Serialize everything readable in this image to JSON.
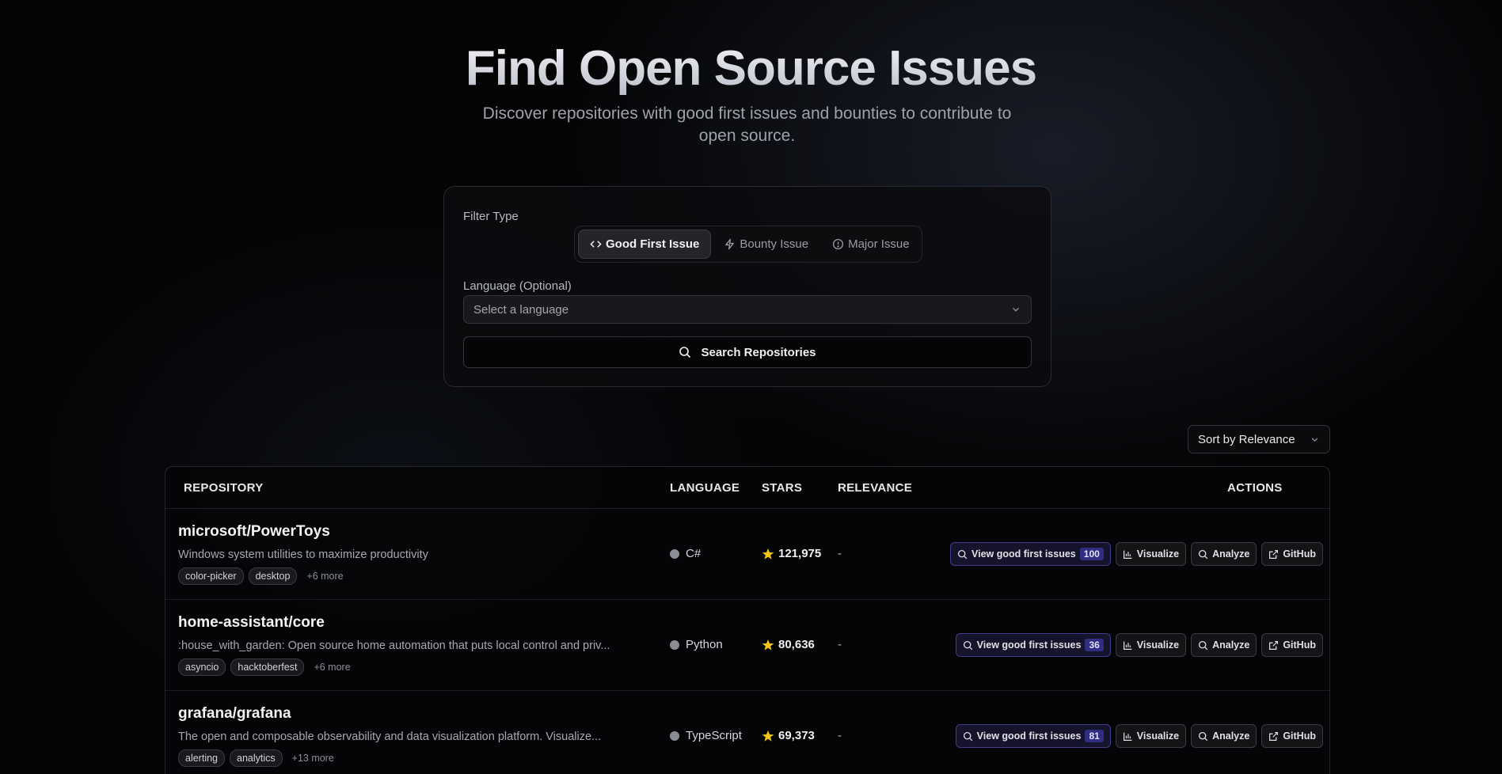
{
  "hero": {
    "title": "Find Open Source Issues",
    "subtitle": "Discover repositories with good first issues and bounties to contribute to open source."
  },
  "filter": {
    "type_label": "Filter Type",
    "types": [
      {
        "label": "Good First Issue",
        "icon": "code-icon",
        "active": true
      },
      {
        "label": "Bounty Issue",
        "icon": "lightning-icon",
        "active": false
      },
      {
        "label": "Major Issue",
        "icon": "alert-circle-icon",
        "active": false
      }
    ],
    "language_label": "Language (Optional)",
    "language_placeholder": "Select a language",
    "search_label": "Search Repositories"
  },
  "sort": {
    "label": "Sort by Relevance"
  },
  "table": {
    "headers": {
      "repository": "REPOSITORY",
      "language": "LANGUAGE",
      "stars": "STARS",
      "relevance": "RELEVANCE",
      "actions": "ACTIONS"
    },
    "action_labels": {
      "view": "View good first issues",
      "visualize": "Visualize",
      "analyze": "Analyze",
      "github": "GitHub"
    },
    "rows": [
      {
        "name": "microsoft/PowerToys",
        "description": "Windows system utilities to maximize productivity",
        "tags": [
          "color-picker",
          "desktop"
        ],
        "more": "+6 more",
        "language": "C#",
        "stars": "121,975",
        "relevance": "-",
        "issue_count": "100"
      },
      {
        "name": "home-assistant/core",
        "description": ":house_with_garden: Open source home automation that puts local control and priv...",
        "tags": [
          "asyncio",
          "hacktoberfest"
        ],
        "more": "+6 more",
        "language": "Python",
        "stars": "80,636",
        "relevance": "-",
        "issue_count": "36"
      },
      {
        "name": "grafana/grafana",
        "description": "The open and composable observability and data visualization platform. Visualize...",
        "tags": [
          "alerting",
          "analytics"
        ],
        "more": "+13 more",
        "language": "TypeScript",
        "stars": "69,373",
        "relevance": "-",
        "issue_count": "81"
      }
    ]
  },
  "colors": {
    "accent": "#312e81",
    "star": "#f5c518"
  }
}
